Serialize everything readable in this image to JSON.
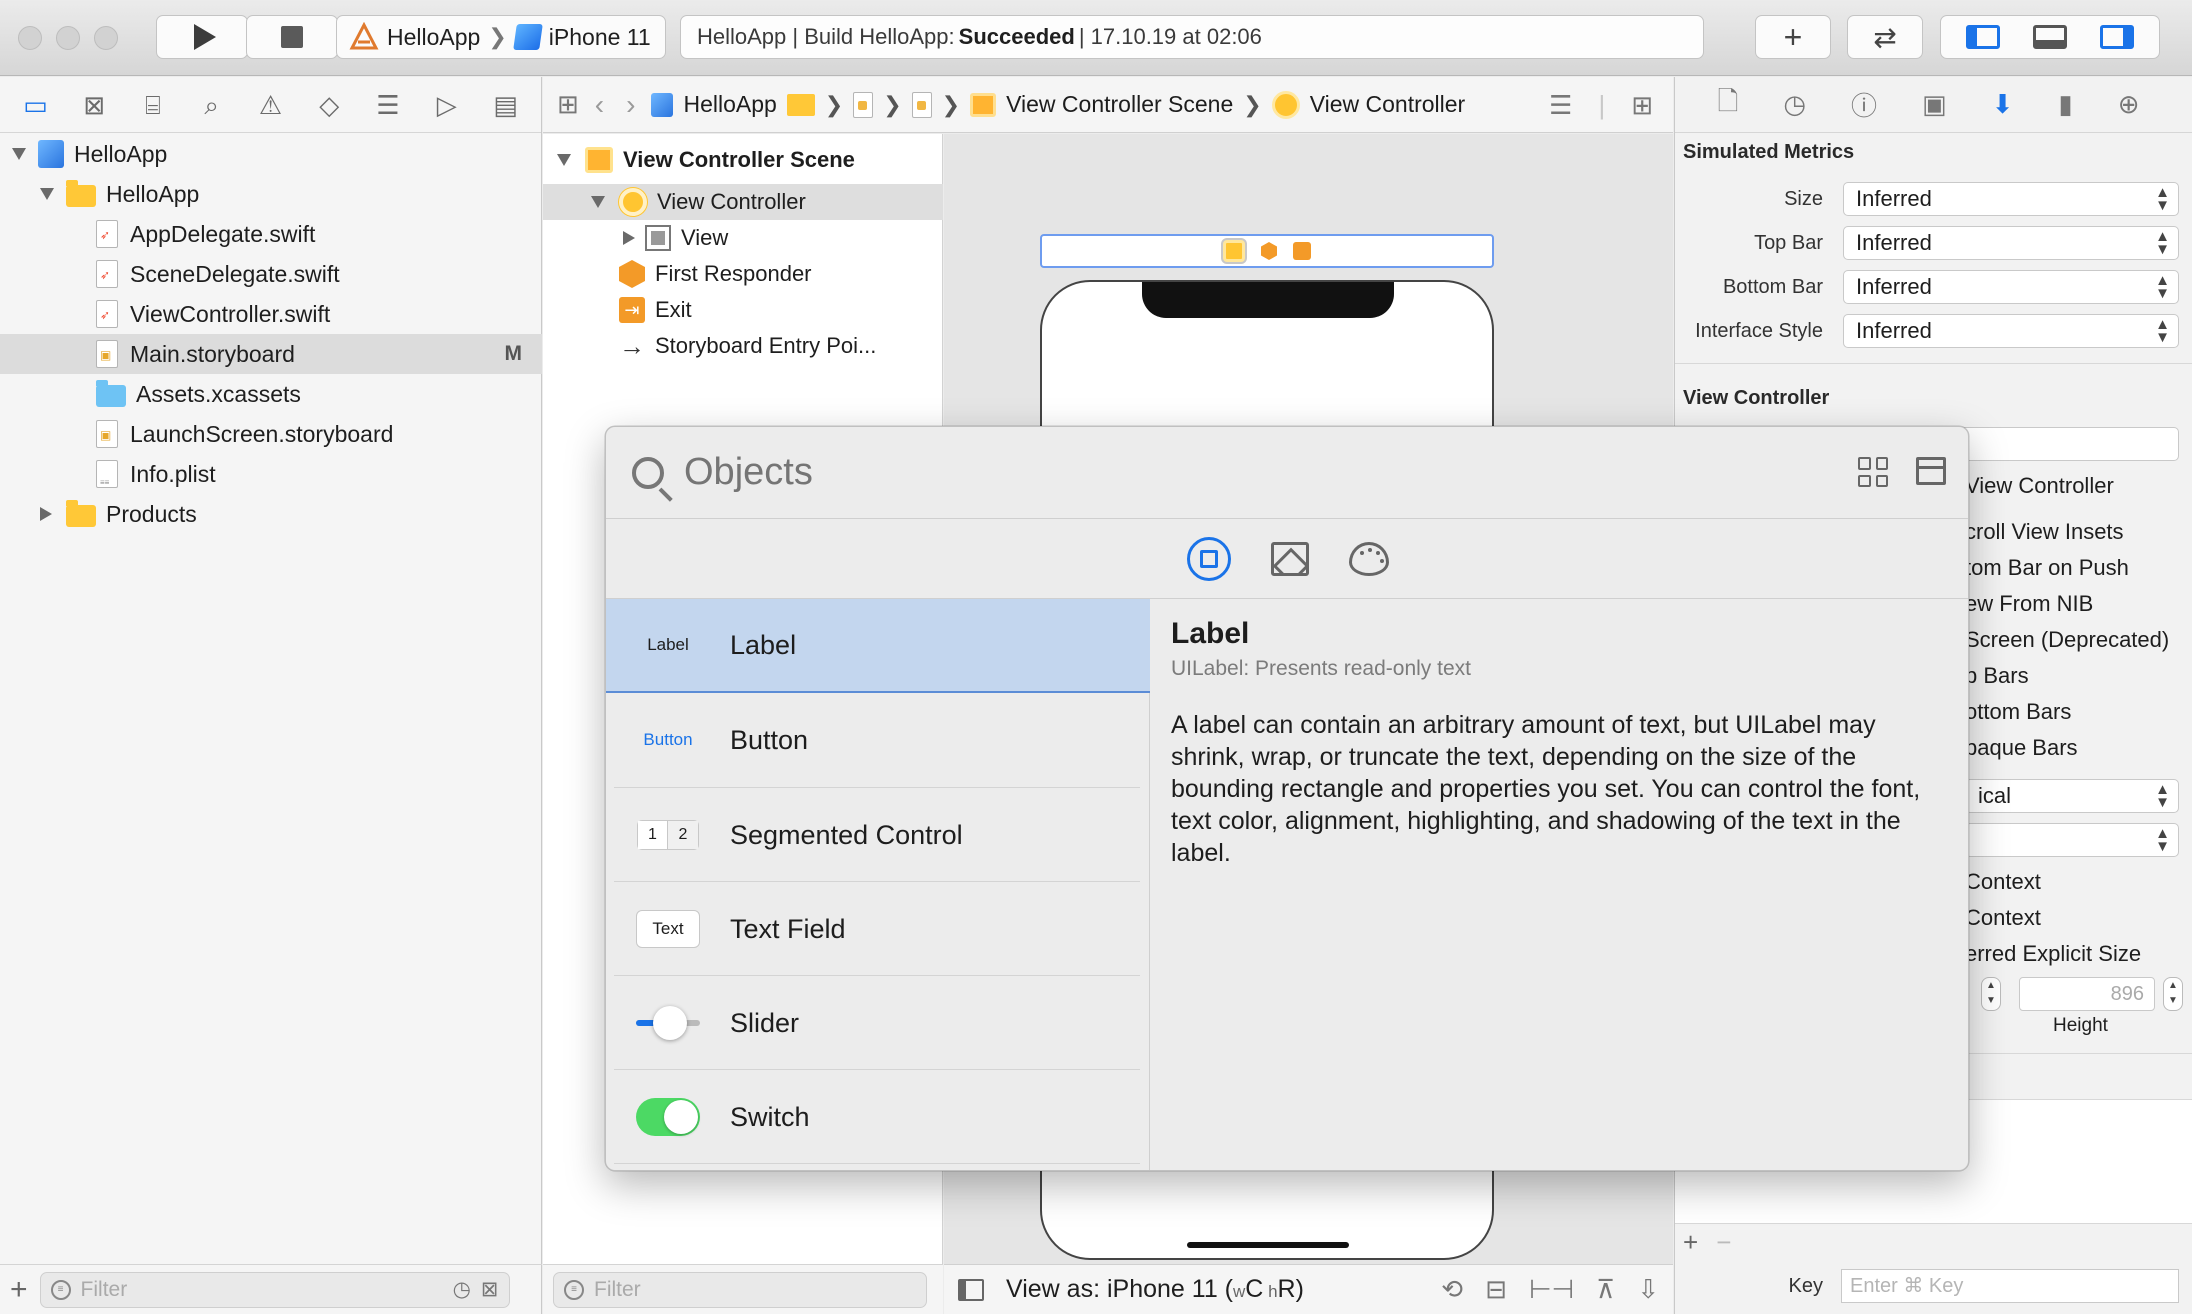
{
  "toolbar": {
    "scheme": {
      "app": "HelloApp",
      "device": "iPhone 11"
    },
    "activity": {
      "prefix": "HelloApp | Build HelloApp:",
      "status": "Succeeded",
      "suffix": "| 17.10.19 at 02:06"
    },
    "add_label": "+",
    "swap_label": "⇄"
  },
  "navigator": {
    "tree": [
      {
        "label": "HelloApp",
        "kind": "project"
      },
      {
        "label": "HelloApp",
        "kind": "group"
      },
      {
        "label": "AppDelegate.swift",
        "kind": "swift"
      },
      {
        "label": "SceneDelegate.swift",
        "kind": "swift"
      },
      {
        "label": "ViewController.swift",
        "kind": "swift"
      },
      {
        "label": "Main.storyboard",
        "kind": "storyboard",
        "badge": "M",
        "selected": true
      },
      {
        "label": "Assets.xcassets",
        "kind": "assets"
      },
      {
        "label": "LaunchScreen.storyboard",
        "kind": "storyboard"
      },
      {
        "label": "Info.plist",
        "kind": "plist"
      },
      {
        "label": "Products",
        "kind": "group"
      }
    ],
    "filter_placeholder": "Filter"
  },
  "jumpbar": {
    "project": "HelloApp",
    "scene": "View Controller Scene",
    "controller": "View Controller"
  },
  "outline": {
    "rows": [
      "View Controller Scene",
      "View Controller",
      "View",
      "First Responder",
      "Exit",
      "Storyboard Entry Poi..."
    ],
    "filter_placeholder": "Filter"
  },
  "canvas_bottom": {
    "view_as": "View as: iPhone 11 (",
    "w": "w",
    "c": "C",
    "h": " h",
    "r": "R",
    "close": ")"
  },
  "inspector": {
    "simulated_metrics_title": "Simulated Metrics",
    "metrics": [
      {
        "label": "Size",
        "value": "Inferred"
      },
      {
        "label": "Top Bar",
        "value": "Inferred"
      },
      {
        "label": "Bottom Bar",
        "value": "Inferred"
      },
      {
        "label": "Interface Style",
        "value": "Inferred"
      }
    ],
    "view_controller_title": "View Controller",
    "partial_rows": [
      "View Controller",
      "croll View Insets",
      "tom Bar on Push",
      "ew From NIB",
      "Screen (Deprecated)",
      "p Bars",
      "ottom Bars",
      "paque Bars"
    ],
    "partial_popup": "ical",
    "partial_rows_2": [
      "Context",
      "Context",
      "erred Explicit Size"
    ],
    "height_value": "896",
    "height_label": "Height",
    "key_label": "Key",
    "key_placeholder": "Enter ⌘ Key"
  },
  "library": {
    "search_placeholder": "Objects",
    "items": [
      {
        "thumb": "Label",
        "name": "Label",
        "selected": true
      },
      {
        "thumb": "Button",
        "name": "Button"
      },
      {
        "thumb_a": "1",
        "thumb_b": "2",
        "name": "Segmented Control"
      },
      {
        "thumb": "Text",
        "name": "Text Field"
      },
      {
        "name": "Slider"
      },
      {
        "name": "Switch"
      }
    ],
    "detail": {
      "title": "Label",
      "subtitle": "UILabel: Presents read-only text",
      "body": "A label can contain an arbitrary amount of text, but UILabel may shrink, wrap, or truncate the text, depending on the size of the bounding rectangle and properties you set. You can control the font, text color, alignment, highlighting, and shadowing of the text in the label."
    }
  },
  "colors": {
    "accent": "#1a73e8",
    "selection": "#c3d6ee",
    "switch_on": "#4cd964",
    "storyboard_orange": "#f39a28"
  }
}
